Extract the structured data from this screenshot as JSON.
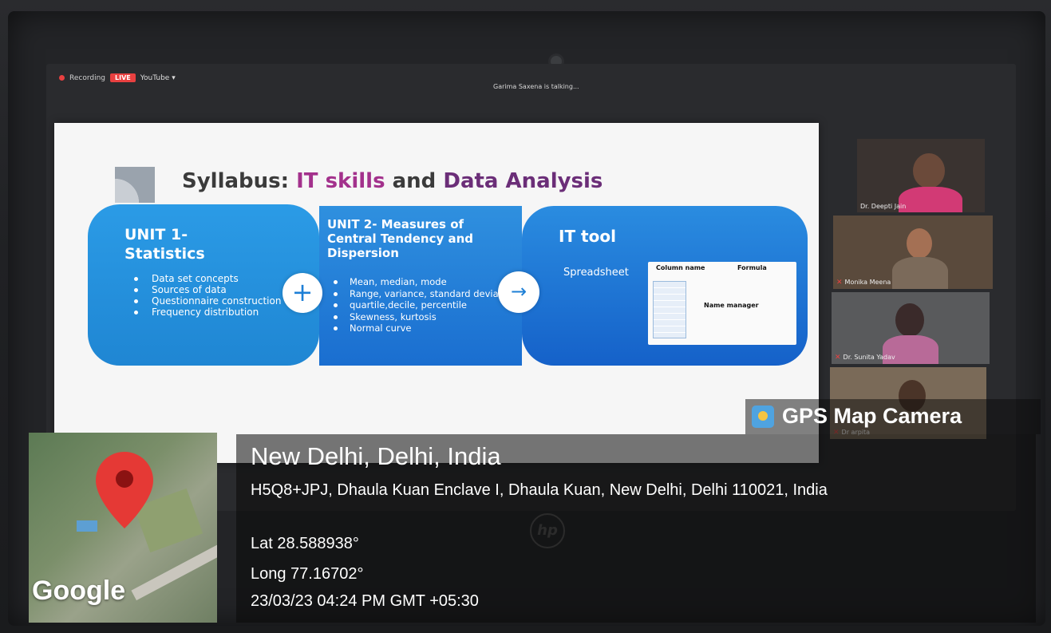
{
  "meeting": {
    "recording_label": "Recording",
    "live_label": "LIVE",
    "stream_target": "YouTube ▾",
    "talking_status": "Garima Saxena is talking..."
  },
  "slide": {
    "title_prefix": "Syllabus:",
    "title_part1": "IT skills",
    "title_part2": "and",
    "title_part3": "Data Analysis",
    "unit1": {
      "heading_line1": "UNIT 1-",
      "heading_line2": "Statistics",
      "items": [
        "Data set concepts",
        "Sources of data",
        "Questionnaire construction",
        "Frequency distribution"
      ]
    },
    "unit2": {
      "heading_line1": "UNIT 2- Measures of",
      "heading_line2": "Central Tendency and",
      "heading_line3": "Dispersion",
      "items": [
        "Mean, median, mode",
        "Range, variance, standard deviation",
        "quartile,decile, percentile",
        "Skewness, kurtosis",
        "Normal curve"
      ]
    },
    "ittool": {
      "heading": "IT tool",
      "spreadsheet_label": "Spreadsheet",
      "column_name_label": "Column name",
      "formula_label": "Formula",
      "name_manager_label": "Name manager"
    }
  },
  "participants": [
    {
      "name": "Dr. Deepti Jain"
    },
    {
      "name": "Monika Meena"
    },
    {
      "name": "Dr. Sunita Yadav"
    },
    {
      "name": "Dr arpita"
    }
  ],
  "gps": {
    "app_name": "GPS Map Camera",
    "map_provider": "Google",
    "place": "New Delhi, Delhi, India",
    "address": "H5Q8+JPJ, Dhaula Kuan Enclave I, Dhaula Kuan, New Delhi, Delhi 110021, India",
    "lat": "Lat 28.588938°",
    "long": "Long 77.16702°",
    "datetime": "23/03/23 04:24 PM GMT +05:30"
  },
  "colors": {
    "accent_blue": "#1f86d3",
    "title_pink": "#a3318c",
    "title_purple": "#6b2e78",
    "live_red": "#e84040"
  }
}
